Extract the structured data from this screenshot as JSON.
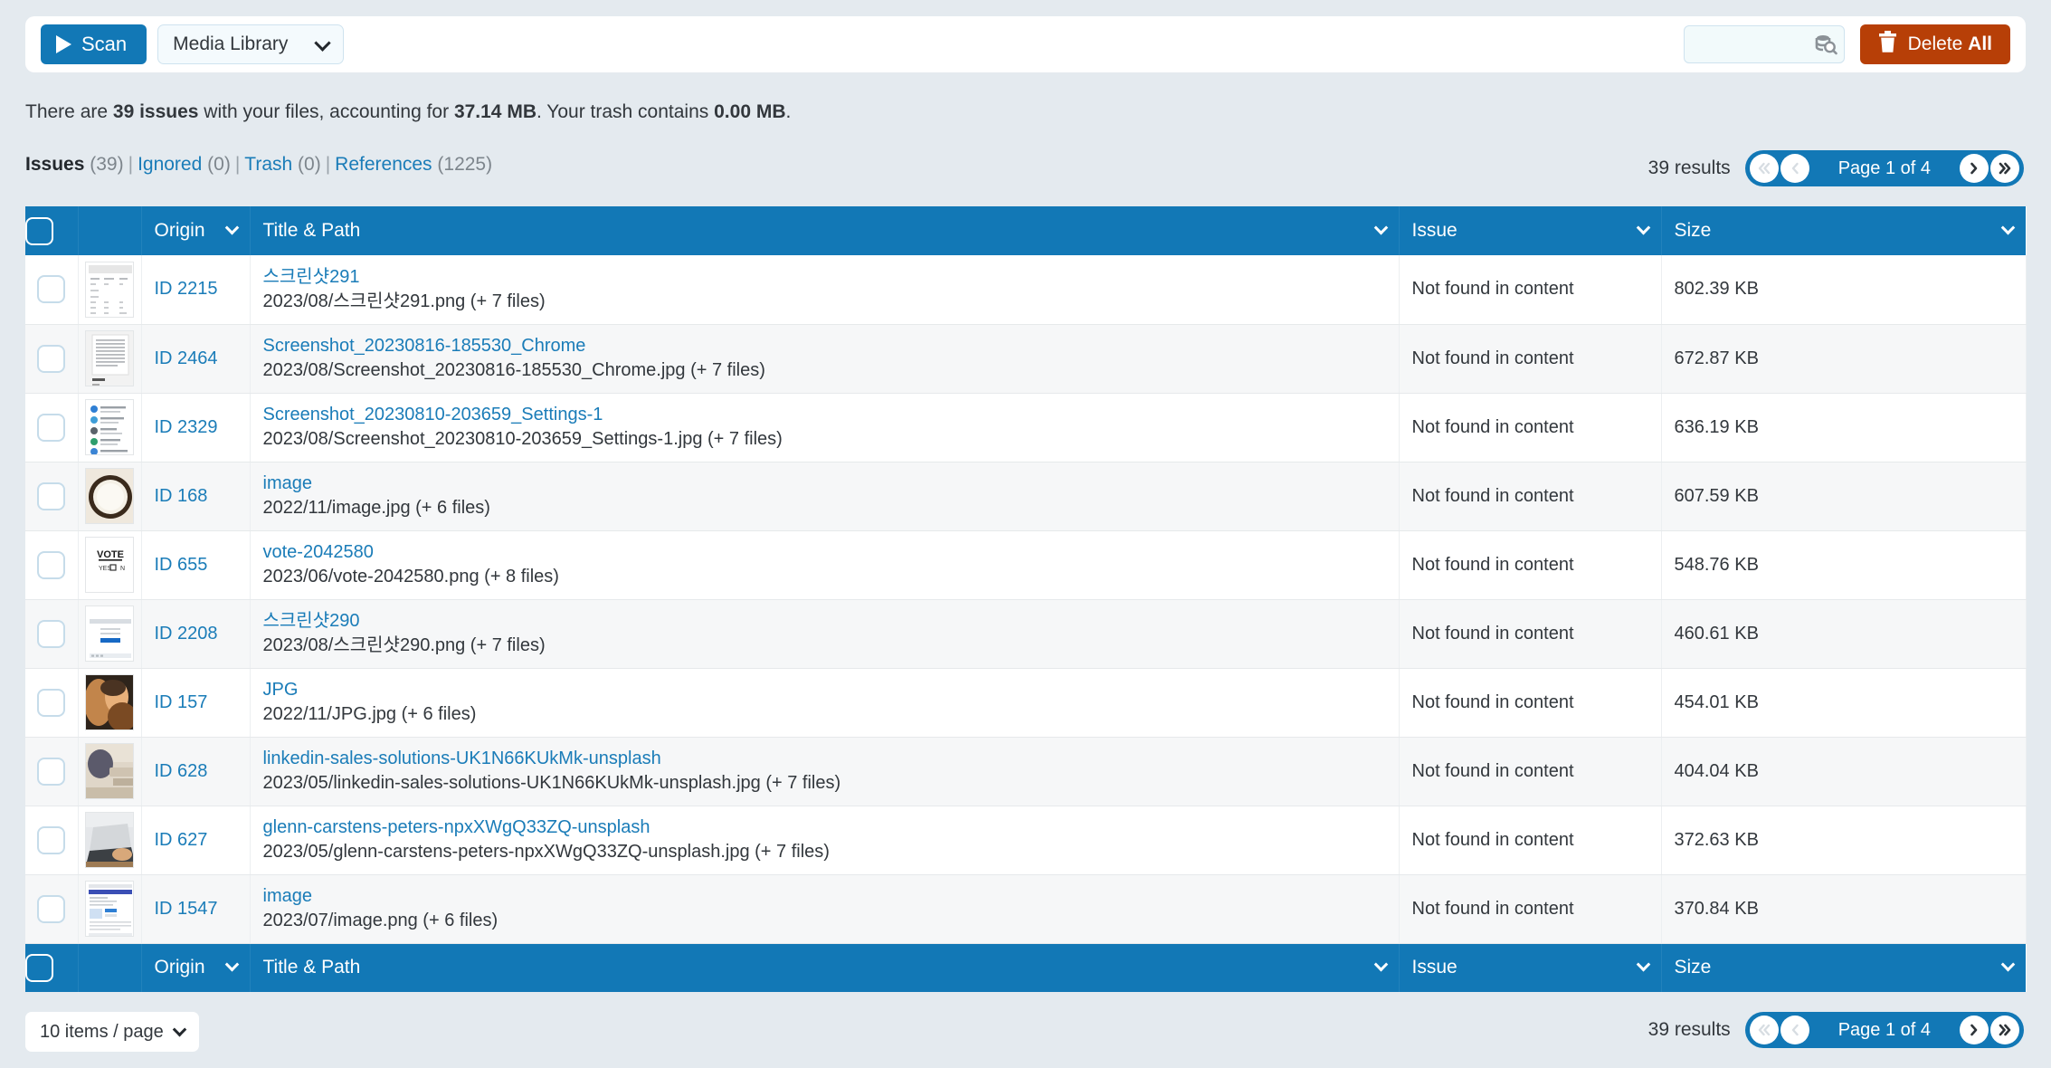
{
  "toolbar": {
    "scan_label": "Scan",
    "scan_icon": "play-icon",
    "source_select_value": "Media Library",
    "search_placeholder": "",
    "search_value": "",
    "search_icon": "database-search-icon",
    "delete_icon": "trash-icon",
    "delete_label_regular": "Delete ",
    "delete_label_bold": "All",
    "colors": {
      "primary_blue": "#1278b6",
      "danger_orange": "#b73f07",
      "page_bg": "#e4eaef"
    }
  },
  "status": {
    "prefix": "There are ",
    "issues_count": "39 issues",
    "middle": " with your files, accounting for ",
    "total_size": "37.14 MB",
    "trash_prefix": ". Your trash contains ",
    "trash_size": "0.00 MB",
    "suffix": "."
  },
  "tabs": [
    {
      "label": "Issues",
      "count": "(39)",
      "active": true
    },
    {
      "label": "Ignored",
      "count": "(0)",
      "active": false
    },
    {
      "label": "Trash",
      "count": "(0)",
      "active": false
    },
    {
      "label": "References",
      "count": "(1225)",
      "active": false
    }
  ],
  "pagination": {
    "results_label": "39 results",
    "page_label": "Page 1 of 4",
    "first_icon": "double-chevron-left-icon",
    "prev_icon": "chevron-left-icon",
    "next_icon": "chevron-right-icon",
    "last_icon": "double-chevron-right-icon"
  },
  "footer": {
    "items_per_page": "10 items / page",
    "chevron_icon": "chevron-down-icon"
  },
  "table": {
    "columns": [
      {
        "key": "check",
        "label": ""
      },
      {
        "key": "thumb",
        "label": ""
      },
      {
        "key": "origin",
        "label": "Origin",
        "sortable": true
      },
      {
        "key": "title",
        "label": "Title & Path",
        "sortable": true
      },
      {
        "key": "issue",
        "label": "Issue",
        "sortable": true
      },
      {
        "key": "size",
        "label": "Size",
        "sortable": true
      }
    ],
    "rows": [
      {
        "origin": "ID 2215",
        "title": "스크린샷291",
        "path": "2023/08/스크린샷291.png (+ 7 files)",
        "issue": "Not found in content",
        "size": "802.39 KB",
        "thumb": "document-table-thumb"
      },
      {
        "origin": "ID 2464",
        "title": "Screenshot_20230816-185530_Chrome",
        "path": "2023/08/Screenshot_20230816-185530_Chrome.jpg (+ 7 files)",
        "issue": "Not found in content",
        "size": "672.87 KB",
        "thumb": "document-text-thumb"
      },
      {
        "origin": "ID 2329",
        "title": "Screenshot_20230810-203659_Settings-1",
        "path": "2023/08/Screenshot_20230810-203659_Settings-1.jpg (+ 7 files)",
        "issue": "Not found in content",
        "size": "636.19 KB",
        "thumb": "settings-list-thumb"
      },
      {
        "origin": "ID 168",
        "title": "image",
        "path": "2022/11/image.jpg (+ 6 files)",
        "issue": "Not found in content",
        "size": "607.59 KB",
        "thumb": "rice-bowl-photo-thumb"
      },
      {
        "origin": "ID 655",
        "title": "vote-2042580",
        "path": "2023/06/vote-2042580.png (+ 8 files)",
        "issue": "Not found in content",
        "size": "548.76 KB",
        "thumb": "vote-ballot-thumb"
      },
      {
        "origin": "ID 2208",
        "title": "스크린샷290",
        "path": "2023/08/스크린샷290.png (+ 7 files)",
        "issue": "Not found in content",
        "size": "460.61 KB",
        "thumb": "browser-window-thumb"
      },
      {
        "origin": "ID 157",
        "title": "JPG",
        "path": "2022/11/JPG.jpg (+ 6 files)",
        "issue": "Not found in content",
        "size": "454.01 KB",
        "thumb": "woman-portrait-photo-thumb"
      },
      {
        "origin": "ID 628",
        "title": "linkedin-sales-solutions-UK1N66KUkMk-unsplash",
        "path": "2023/05/linkedin-sales-solutions-UK1N66KUkMk-unsplash.jpg (+ 7 files)",
        "issue": "Not found in content",
        "size": "404.04 KB",
        "thumb": "desk-meeting-photo-thumb"
      },
      {
        "origin": "ID 627",
        "title": "glenn-carstens-peters-npxXWgQ33ZQ-unsplash",
        "path": "2023/05/glenn-carstens-peters-npxXWgQ33ZQ-unsplash.jpg (+ 7 files)",
        "issue": "Not found in content",
        "size": "372.63 KB",
        "thumb": "laptop-typing-photo-thumb"
      },
      {
        "origin": "ID 1547",
        "title": "image",
        "path": "2023/07/image.png (+ 6 files)",
        "issue": "Not found in content",
        "size": "370.84 KB",
        "thumb": "webpage-screenshot-thumb"
      }
    ]
  }
}
